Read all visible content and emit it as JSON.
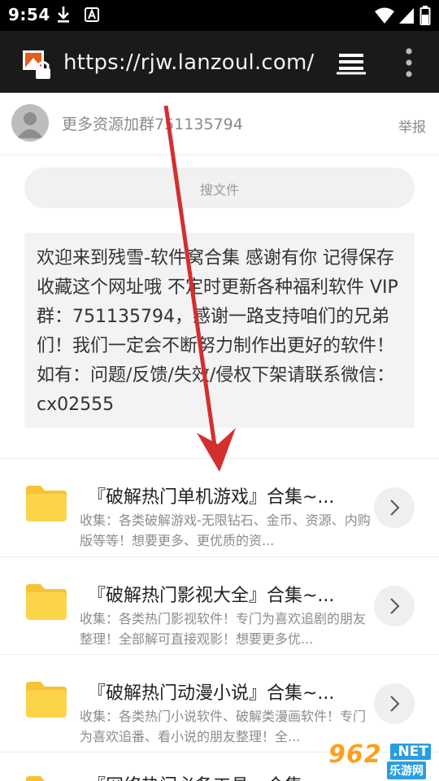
{
  "status_bar": {
    "time": "9:54",
    "icons": [
      "download-icon",
      "a-notification-icon",
      "wifi-icon",
      "signal-icon",
      "battery-icon"
    ]
  },
  "browser": {
    "url": "https://rjw.lanzoul.com/s/",
    "icons": [
      "site-icon",
      "tabs-icon",
      "menu-icon"
    ]
  },
  "profile": {
    "text": "更多资源加群751135794",
    "report_label": "举报"
  },
  "search": {
    "placeholder": "搜文件"
  },
  "announcement": {
    "text": "欢迎来到残雪-软件窝合集 感谢有你 记得保存收藏这个网址哦 不定时更新各种福利软件 VIP群：751135794，感谢一路支持咱们的兄弟们！我们一定会不断努力制作出更好的软件！如有：问题/反馈/失效/侵权下架请联系微信：cx02555"
  },
  "folders": [
    {
      "title": "『破解热门单机游戏』合集~...",
      "description": "收集：各类破解游戏-无限钻石、金币、资源、内购版等等！想要更多、更优质的资..."
    },
    {
      "title": "『破解热门影视大全』合集~...",
      "description": "收集：各类热门影视软件！专门为喜欢追剧的朋友整理！全部解可直接观影！想要更多优..."
    },
    {
      "title": "『破解热门动漫小说』合集~...",
      "description": "收集：各类热门小说软件、破解类漫画软件！专门为喜欢追番、看小说的朋友整理！全..."
    },
    {
      "title": "『网络热门必备工具』合集~..."
    }
  ],
  "watermark": {
    "number": "962",
    "net": ".NET",
    "site": "乐游网"
  },
  "colors": {
    "arrow": "#d32f2f",
    "folder": "#fbd44a",
    "toolbar": "#1a1a1a"
  }
}
